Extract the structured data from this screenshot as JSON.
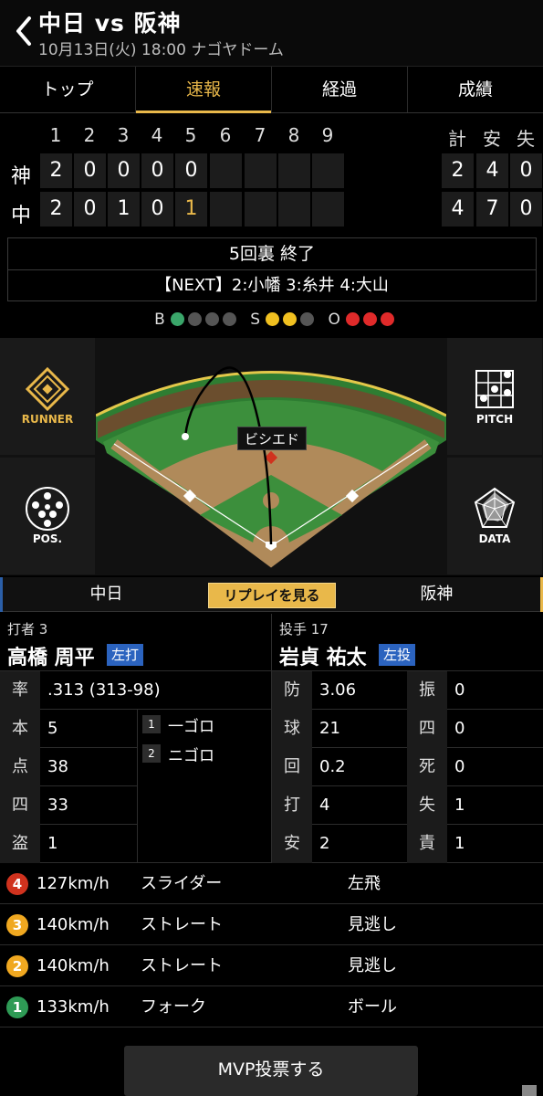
{
  "header": {
    "title": "中日 vs 阪神",
    "subtitle": "10月13日(火) 18:00 ナゴヤドーム"
  },
  "tabs": [
    {
      "label": "トップ",
      "active": false
    },
    {
      "label": "速報",
      "active": true
    },
    {
      "label": "経過",
      "active": false
    },
    {
      "label": "成績",
      "active": false
    }
  ],
  "scoreboard": {
    "innings": [
      "1",
      "2",
      "3",
      "4",
      "5",
      "6",
      "7",
      "8",
      "9"
    ],
    "totals_headers": [
      "計",
      "安",
      "失"
    ],
    "teams": [
      {
        "abbr": "神",
        "innings": [
          "2",
          "0",
          "0",
          "0",
          "0",
          "",
          "",
          "",
          ""
        ],
        "totals": [
          "2",
          "4",
          "0"
        ]
      },
      {
        "abbr": "中",
        "innings": [
          "2",
          "0",
          "1",
          "0",
          "1",
          "",
          "",
          "",
          ""
        ],
        "totals": [
          "4",
          "7",
          "0"
        ]
      }
    ]
  },
  "status": {
    "inning": "5回裏 終了",
    "next": "【NEXT】2:小幡 3:糸井 4:大山"
  },
  "count": {
    "labels": [
      "B",
      "S",
      "O"
    ],
    "balls": 1,
    "strikes": 2,
    "outs": 3,
    "colors": {
      "ball": "#3aa66a",
      "strike": "#f0c020",
      "out": "#e02a2a",
      "off": "#555555"
    }
  },
  "field": {
    "batter_tag": "ビシエド"
  },
  "side_buttons": {
    "runner": "RUNNER",
    "pitch": "PITCH",
    "pos": "POS.",
    "data": "DATA"
  },
  "team_row": {
    "left": "中日",
    "replay": "リプレイを見る",
    "right": "阪神"
  },
  "batter": {
    "role": "打者 3",
    "name": "高橋 周平",
    "badge": "左打",
    "stats": [
      {
        "label": "率",
        "value": ".313 (313-98)"
      },
      {
        "label": "本",
        "value": "5"
      },
      {
        "label": "点",
        "value": "38"
      },
      {
        "label": "四",
        "value": "33"
      },
      {
        "label": "盗",
        "value": "1"
      }
    ],
    "at_bats": [
      {
        "no": "1",
        "result": "一ゴロ"
      },
      {
        "no": "2",
        "result": "ニゴロ"
      }
    ]
  },
  "pitcher": {
    "role": "投手 17",
    "name": "岩貞 祐太",
    "badge": "左投",
    "stats_left": [
      {
        "label": "防",
        "value": "3.06"
      },
      {
        "label": "球",
        "value": "21"
      },
      {
        "label": "回",
        "value": "0.2"
      },
      {
        "label": "打",
        "value": "4"
      },
      {
        "label": "安",
        "value": "2"
      }
    ],
    "stats_right": [
      {
        "label": "振",
        "value": "0"
      },
      {
        "label": "四",
        "value": "0"
      },
      {
        "label": "死",
        "value": "0"
      },
      {
        "label": "失",
        "value": "1"
      },
      {
        "label": "責",
        "value": "1"
      }
    ]
  },
  "pitches": [
    {
      "no": "4",
      "speed": "127km/h",
      "type": "スライダー",
      "result": "左飛",
      "color": "#d0321e"
    },
    {
      "no": "3",
      "speed": "140km/h",
      "type": "ストレート",
      "result": "見逃し",
      "color": "#f0a820"
    },
    {
      "no": "2",
      "speed": "140km/h",
      "type": "ストレート",
      "result": "見逃し",
      "color": "#f0a820"
    },
    {
      "no": "1",
      "speed": "133km/h",
      "type": "フォーク",
      "result": "ボール",
      "color": "#2e9a55"
    }
  ],
  "mvp_button": "MVP投票する"
}
